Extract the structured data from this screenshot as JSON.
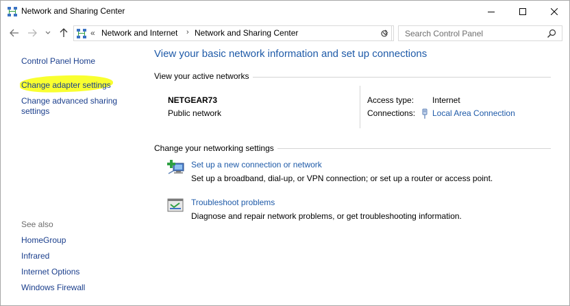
{
  "window": {
    "title": "Network and Sharing Center"
  },
  "address": {
    "overflow": "«",
    "crumbs": [
      "Network and Internet",
      "Network and Sharing Center"
    ],
    "separator": "›"
  },
  "search": {
    "placeholder": "Search Control Panel"
  },
  "sidebar": {
    "home": "Control Panel Home",
    "change_adapter": "Change adapter settings",
    "change_sharing": "Change advanced sharing settings",
    "see_also_label": "See also",
    "see_also": [
      "HomeGroup",
      "Infrared",
      "Internet Options",
      "Windows Firewall"
    ]
  },
  "main": {
    "title": "View your basic network information and set up connections",
    "active_networks_header": "View your active networks",
    "network": {
      "name": "NETGEAR73",
      "type": "Public network",
      "access_type_label": "Access type:",
      "access_type_value": "Internet",
      "connections_label": "Connections:",
      "connection_link": "Local Area Connection"
    },
    "settings_header": "Change your networking settings",
    "tasks": [
      {
        "icon": "new-connection-icon",
        "link": "Set up a new connection or network",
        "desc": "Set up a broadband, dial-up, or VPN connection; or set up a router or access point."
      },
      {
        "icon": "troubleshoot-icon",
        "link": "Troubleshoot problems",
        "desc": "Diagnose and repair network problems, or get troubleshooting information."
      }
    ]
  },
  "colors": {
    "link": "#1e5aa8",
    "sidebar_link": "#1a3e8c",
    "highlight": "#f8ff1a"
  }
}
